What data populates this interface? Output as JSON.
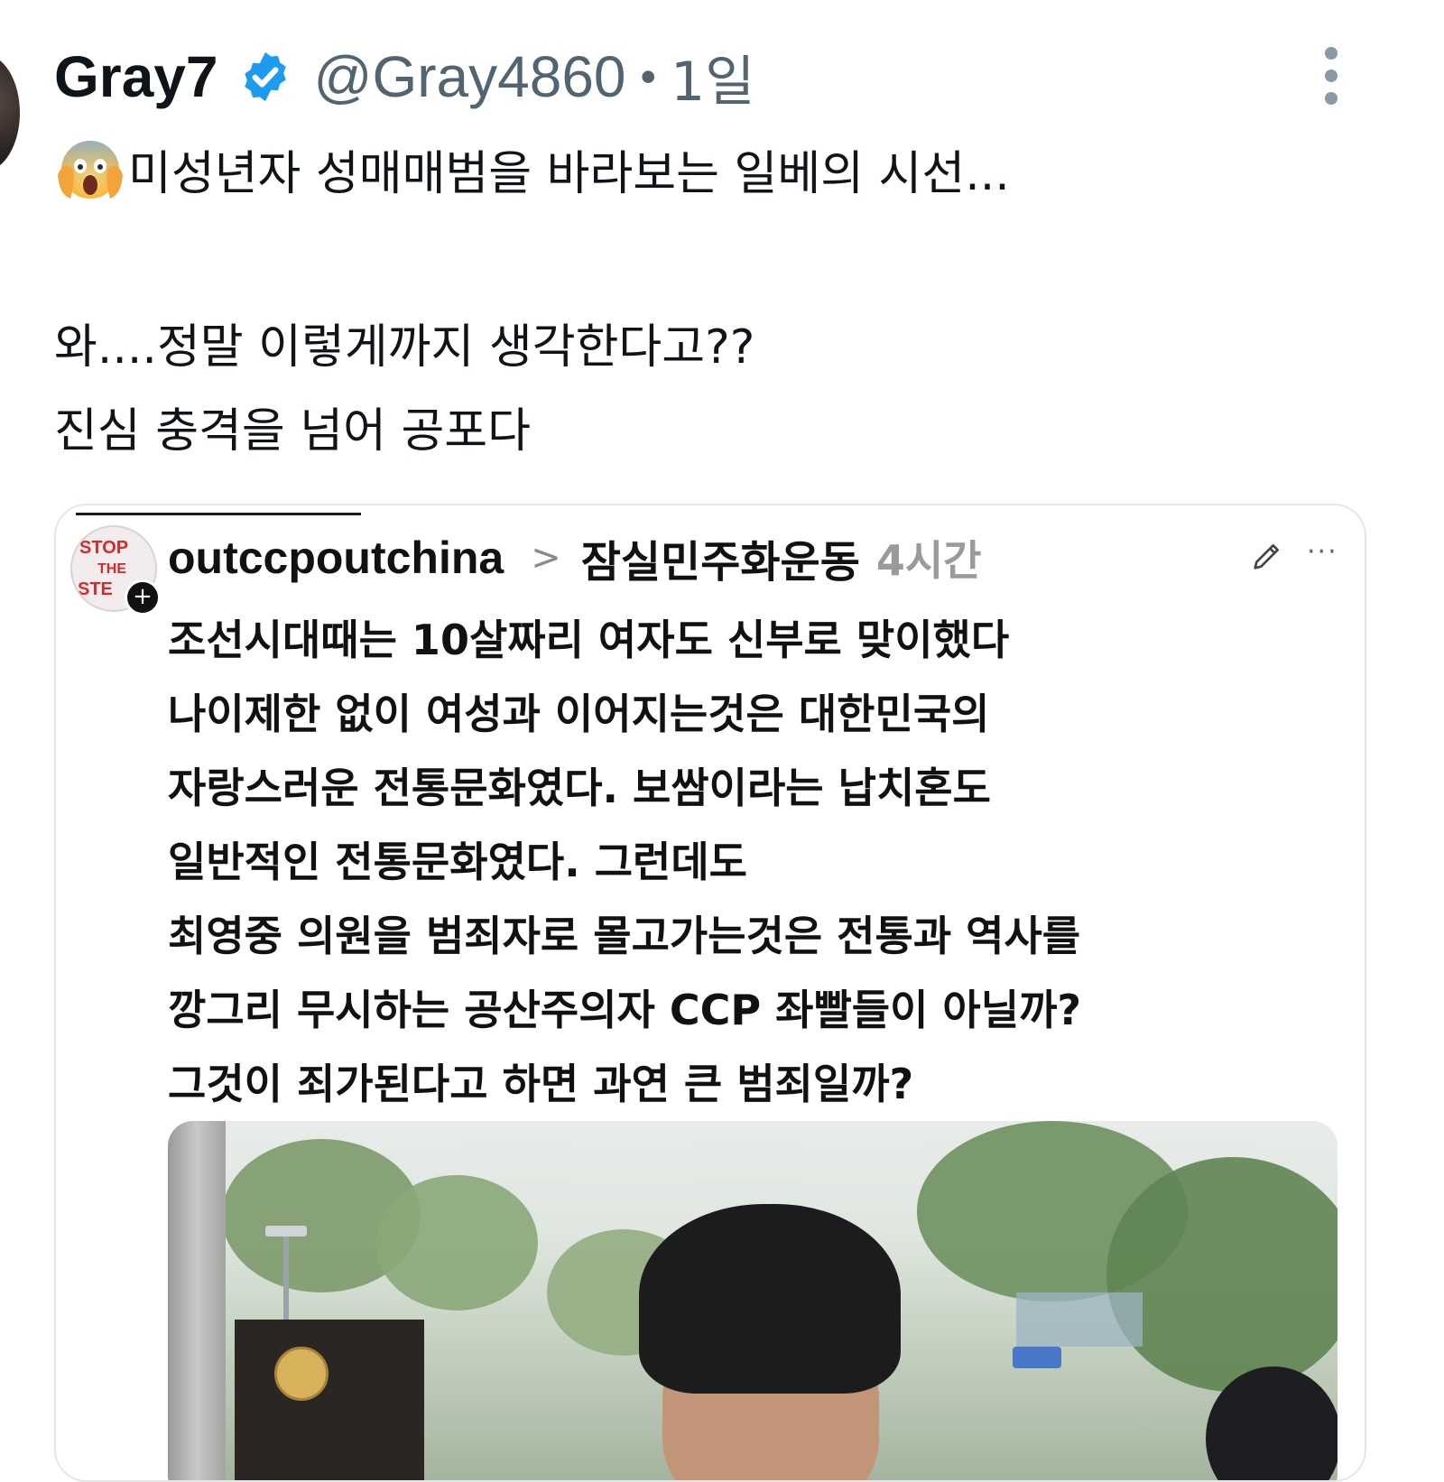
{
  "tweet": {
    "display_name": "Gray7",
    "handle": "@Gray4860",
    "separator": "•",
    "time": "1일",
    "lines": [
      "미성년자 성매매범을 바라보는 일베의 시선...",
      "와....정말 이렇게까지 생각한다고??",
      "진심 충격을 넘어 공포다"
    ],
    "emoji": "face-screaming-in-fear",
    "verified_color": "#1d9bf0"
  },
  "quote": {
    "avatar_text": [
      "STOP",
      "THE",
      "STE"
    ],
    "author": "outccpoutchina",
    "chevron": ">",
    "community": "잠실민주화운동",
    "time": "4시간",
    "more": "···",
    "lines": [
      "조선시대때는 10살짜리 여자도 신부로 맞이했다",
      "나이제한 없이 여성과 이어지는것은 대한민국의",
      "자랑스러운 전통문화였다. 보쌈이라는 납치혼도",
      "일반적인 전통문화였다. 그런데도",
      "최영중 의원을 범죄자로 몰고가는것은 전통과 역사를",
      "깡그리 무시하는 공산주의자 CCP 좌빨들이 아닐까?",
      "그것이 죄가된다고 하면 과연 큰 범죄일까?"
    ]
  }
}
